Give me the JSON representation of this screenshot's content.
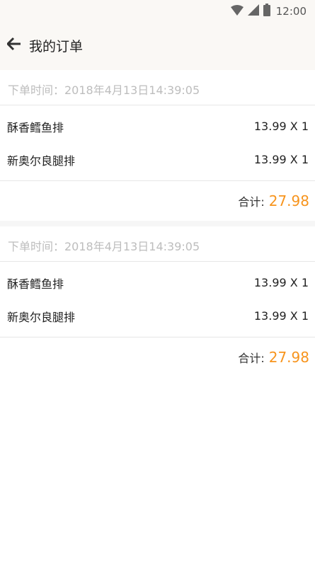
{
  "status_bar": {
    "time": "12:00",
    "icons": [
      "wifi-icon",
      "signal-icon",
      "battery-icon"
    ]
  },
  "header": {
    "back_icon": "arrow-left-icon",
    "title": "我的订单"
  },
  "orders": [
    {
      "time_label": "下单时间：2018年4月13日14:39:05",
      "items": [
        {
          "name": "酥香鳕鱼排",
          "price_qty": "13.99 X 1"
        },
        {
          "name": "新奥尔良腿排",
          "price_qty": "13.99 X 1"
        }
      ],
      "total_label": "合计:",
      "total_value": "27.98"
    },
    {
      "time_label": "下单时间：2018年4月13日14:39:05",
      "items": [
        {
          "name": "酥香鳕鱼排",
          "price_qty": "13.99 X 1"
        },
        {
          "name": "新奥尔良腿排",
          "price_qty": "13.99 X 1"
        }
      ],
      "total_label": "合计:",
      "total_value": "27.98"
    }
  ],
  "colors": {
    "accent": "#f7941d",
    "header_bg": "#faf8f5",
    "muted_text": "#bdbdbd",
    "divider": "#e6e6e6"
  }
}
